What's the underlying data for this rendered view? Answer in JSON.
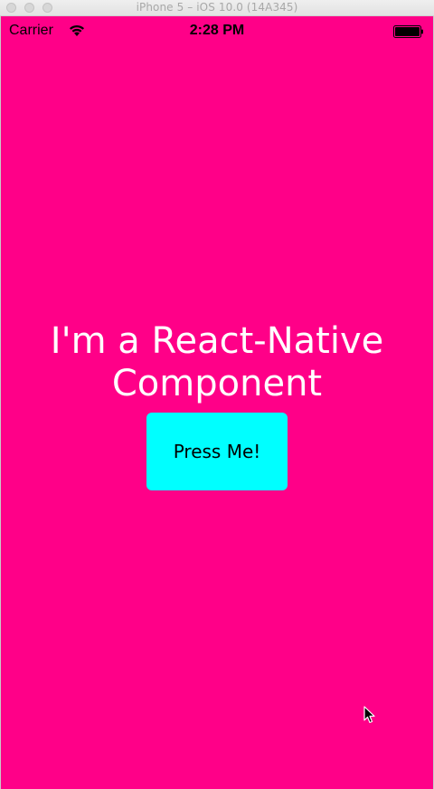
{
  "window": {
    "title": "iPhone 5 – iOS 10.0 (14A345)"
  },
  "statusbar": {
    "carrier": "Carrier",
    "time": "2:28 PM",
    "wifi_icon": "wifi-icon",
    "battery_icon": "battery-icon"
  },
  "main": {
    "headline_line1": "I'm a React-Native",
    "headline_line2": "Component",
    "button_label": "Press Me!"
  },
  "colors": {
    "background": "#ff0088",
    "button": "#00ffff",
    "headline_text": "#ffffff"
  }
}
